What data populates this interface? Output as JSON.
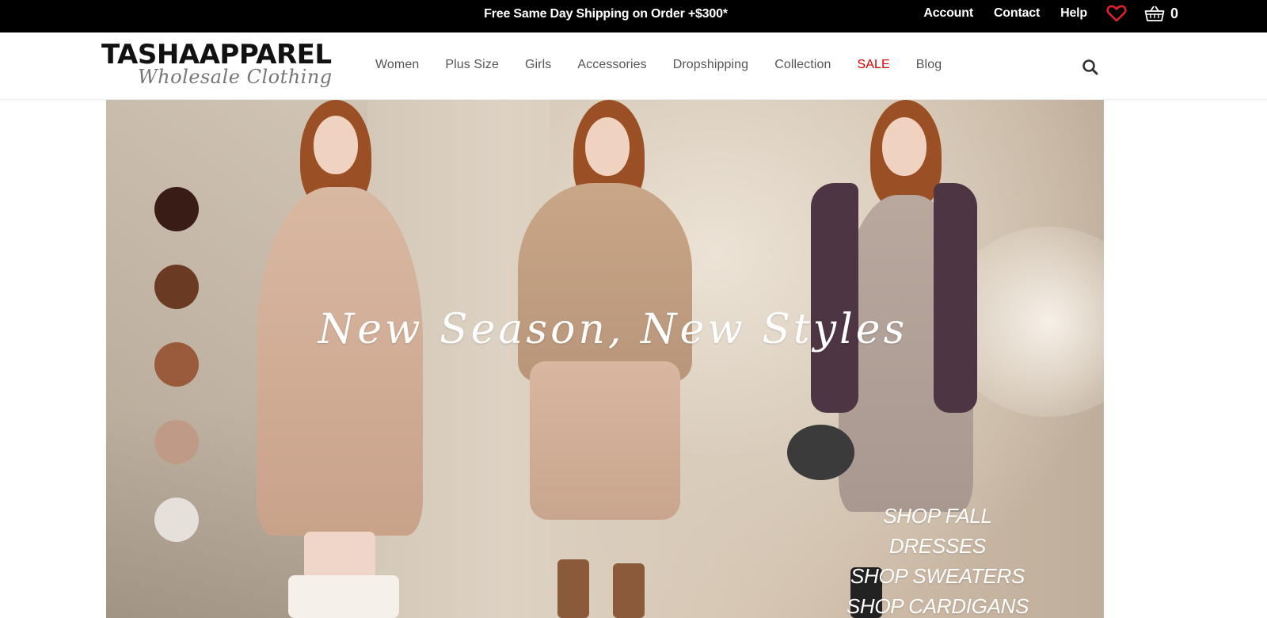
{
  "topbar": {
    "promo": "Free Same Day Shipping on Order +$300*",
    "links": [
      "Account",
      "Contact",
      "Help"
    ],
    "cart_count": "0",
    "heart_color": "#e0202e"
  },
  "header": {
    "logo_main": "TASHAAPPAREL",
    "logo_sub": "Wholesale Clothing",
    "nav": [
      {
        "label": "Women",
        "color": "#555555"
      },
      {
        "label": "Plus Size",
        "color": "#555555"
      },
      {
        "label": "Girls",
        "color": "#555555"
      },
      {
        "label": "Accessories",
        "color": "#555555"
      },
      {
        "label": "Dropshipping",
        "color": "#555555"
      },
      {
        "label": "Collection",
        "color": "#555555"
      },
      {
        "label": "SALE",
        "color": "#d90000"
      },
      {
        "label": "Blog",
        "color": "#555555"
      }
    ]
  },
  "hero": {
    "title": "New Season, New Styles",
    "swatches": [
      "#3a1c17",
      "#6b3a22",
      "#9a5a3c",
      "#bf9a86",
      "#e6e0da"
    ],
    "shop_links": [
      "SHOP FALL DRESSES",
      "SHOP SWEATERS",
      "SHOP CARDIGANS"
    ]
  }
}
